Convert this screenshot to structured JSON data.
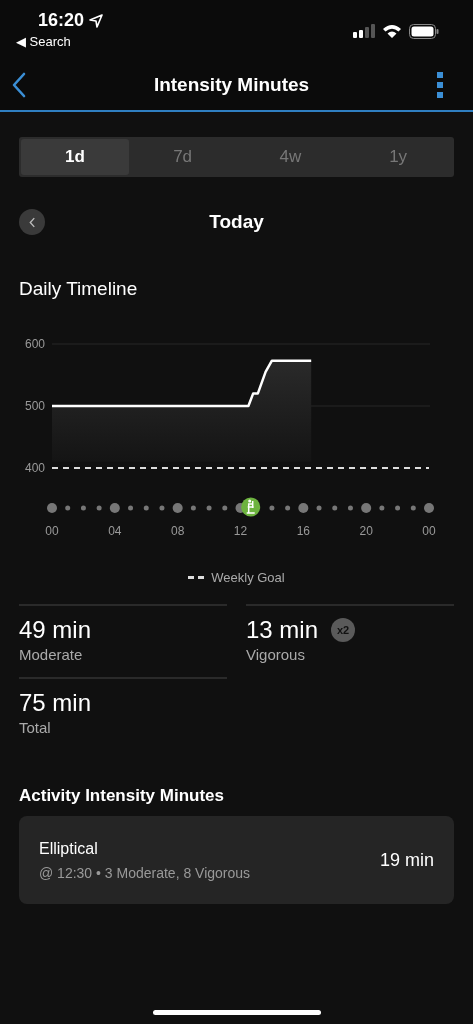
{
  "status_bar": {
    "time": "16:20",
    "back_label": "◀ Search"
  },
  "nav": {
    "title": "Intensity Minutes"
  },
  "tabs": [
    {
      "label": "1d",
      "selected": true
    },
    {
      "label": "7d",
      "selected": false
    },
    {
      "label": "4w",
      "selected": false
    },
    {
      "label": "1y",
      "selected": false
    }
  ],
  "date": {
    "label": "Today"
  },
  "timeline": {
    "title": "Daily Timeline",
    "chart_data": {
      "type": "line",
      "x": [
        0,
        12.5,
        12.8,
        13.1,
        13.6,
        14,
        16.5,
        24
      ],
      "xlim": [
        0,
        24
      ],
      "ylim": [
        400,
        600
      ],
      "xticks": [
        {
          "value": 0,
          "label": "00"
        },
        {
          "value": 4,
          "label": "04"
        },
        {
          "value": 8,
          "label": "08"
        },
        {
          "value": 12,
          "label": "12"
        },
        {
          "value": 16,
          "label": "16"
        },
        {
          "value": 20,
          "label": "20"
        },
        {
          "value": 24,
          "label": "00"
        }
      ],
      "yticks": [
        400,
        500,
        600
      ],
      "series": [
        {
          "color": "#ffffff",
          "values": [
            500,
            500,
            520,
            520,
            555,
            573,
            573,
            null
          ]
        },
        {
          "name": "Weekly Goal",
          "color": "#dddddd",
          "line_style": "dashed",
          "values": [
            400,
            400,
            400,
            400,
            400,
            400,
            400,
            400
          ]
        }
      ]
    }
  },
  "stats": [
    {
      "value": "49 min",
      "label": "Moderate"
    },
    {
      "value": "13 min",
      "label": "Vigorous",
      "badge": "x2"
    },
    {
      "value": "75 min",
      "label": "Total"
    }
  ],
  "activities": {
    "title": "Activity Intensity Minutes",
    "items": [
      {
        "name": "Elliptical",
        "detail": "@ 12:30 • 3 Moderate, 8 Vigorous",
        "minutes": "19 min"
      }
    ]
  }
}
